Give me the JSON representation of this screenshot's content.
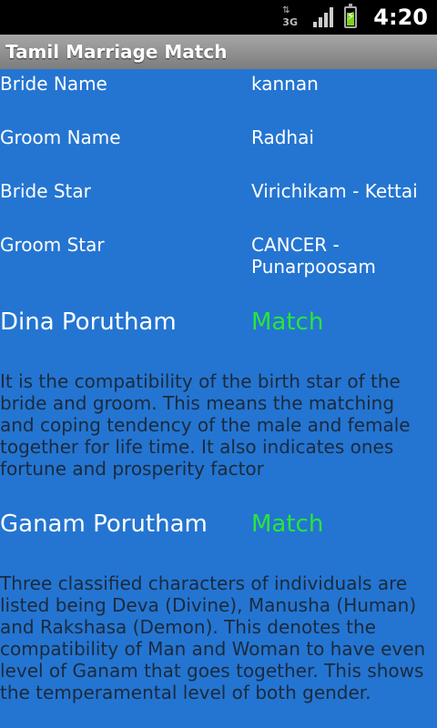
{
  "status_bar": {
    "network": "3G",
    "time": "4:20"
  },
  "app": {
    "title": "Tamil Marriage Match"
  },
  "details": [
    {
      "label": "Bride Name",
      "value": "kannan"
    },
    {
      "label": "Groom Name",
      "value": "Radhai"
    },
    {
      "label": "Bride Star",
      "value": "Virichikam - Kettai"
    },
    {
      "label": "Groom Star",
      "value": "CANCER - Punarpoosam"
    }
  ],
  "poruthams": [
    {
      "name": "Dina Porutham",
      "result": "Match",
      "description": "It is the compatibility of the birth star of the bride and groom. This means the matching and coping tendency of the male and female together for life time. It also indicates ones fortune and prosperity factor"
    },
    {
      "name": "Ganam Porutham",
      "result": "Match",
      "description": "Three classified characters of individuals are listed being Deva (Divine), Manusha (Human) and Rakshasa (Demon). This denotes the compatibility of Man and Woman to have even level of Ganam that goes together. This shows the temperamental level of both gender."
    }
  ],
  "colors": {
    "background": "#2475d1",
    "match": "#28e639",
    "description_text": "#1b2a3e"
  }
}
